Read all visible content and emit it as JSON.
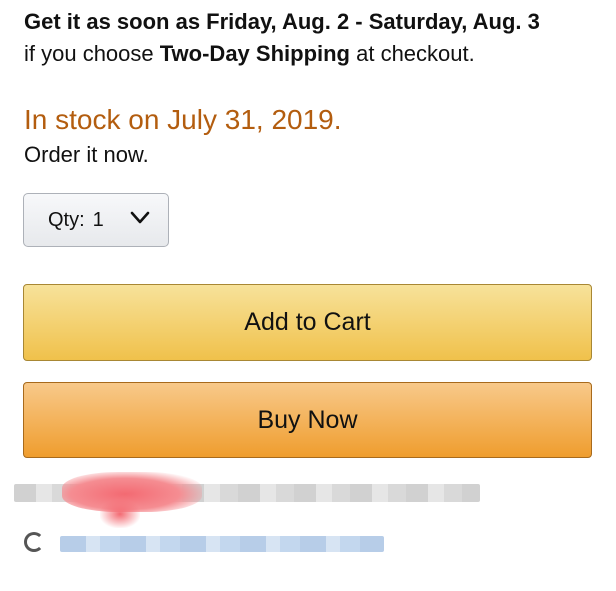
{
  "delivery": {
    "line1": "Get it as soon as Friday, Aug. 2 - Saturday, Aug. 3",
    "line2_prefix": "if you choose ",
    "line2_bold": "Two-Day Shipping",
    "line2_suffix": " at checkout."
  },
  "stock": {
    "status": "In stock on July 31, 2019.",
    "note": "Order it now."
  },
  "quantity": {
    "label": "Qty:",
    "value": "1"
  },
  "buttons": {
    "add_to_cart": "Add to Cart",
    "buy_now": "Buy Now"
  },
  "colors": {
    "stock_text": "#b35d0f",
    "add_to_cart_bg": "#f0c14b",
    "buy_now_bg": "#ef9d2e"
  }
}
